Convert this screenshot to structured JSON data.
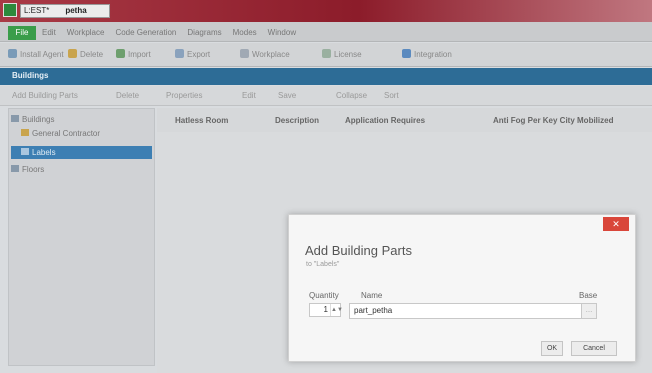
{
  "window": {
    "title_part1": "L:EST*",
    "title_part2": "petha"
  },
  "menubar": {
    "file": "File",
    "items": [
      "Edit",
      "Workplace",
      "Code Generation",
      "Diagrams",
      "Modes",
      "Window"
    ]
  },
  "toolbar": {
    "buttons": [
      {
        "label": "Install Agent",
        "icon": "agent-icon",
        "color": "#7a9bb8"
      },
      {
        "label": "Delete",
        "icon": "delete-icon",
        "color": "#c9a44d"
      },
      {
        "label": "Import",
        "icon": "import-icon",
        "color": "#6e9f6e"
      },
      {
        "label": "Export",
        "icon": "export-icon",
        "color": "#8aa2bd"
      },
      {
        "label": "Workplace",
        "icon": "workplace-icon",
        "color": "#a0a9b4"
      },
      {
        "label": "License",
        "icon": "license-icon",
        "color": "#9ab0a0"
      },
      {
        "label": "Integration",
        "icon": "integration-icon",
        "color": "#5b8abf"
      }
    ]
  },
  "nav": {
    "title": "Buildings"
  },
  "cmdbar": {
    "items": [
      "Add Building Parts",
      "Delete",
      "Properties",
      "Edit",
      "Save",
      "Collapse",
      "Sort"
    ]
  },
  "tree": {
    "items": [
      {
        "label": "Buildings",
        "icon": "folder-icon",
        "selected": false
      },
      {
        "label": "General Contractor",
        "icon": "folder-icon",
        "selected": false
      },
      {
        "label": "Labels",
        "icon": "folder-icon",
        "selected": true
      },
      {
        "label": "Floors",
        "icon": "folder-icon",
        "selected": false
      }
    ]
  },
  "grid": {
    "columns": [
      "Hatless Room",
      "Description",
      "Application Requires",
      "Anti Fog Per Key City Mobilized"
    ]
  },
  "dialog": {
    "title": "Add Building Parts",
    "subtitle": "to \"Labels\"",
    "labels": {
      "quantity": "Quantity",
      "name": "Name",
      "base": "Base"
    },
    "quantity_value": "1",
    "name_value": "part_petha",
    "ok": "OK",
    "cancel": "Cancel",
    "close_glyph": "✕",
    "spin_glyph": "▲▼",
    "base_glyph": "…"
  }
}
